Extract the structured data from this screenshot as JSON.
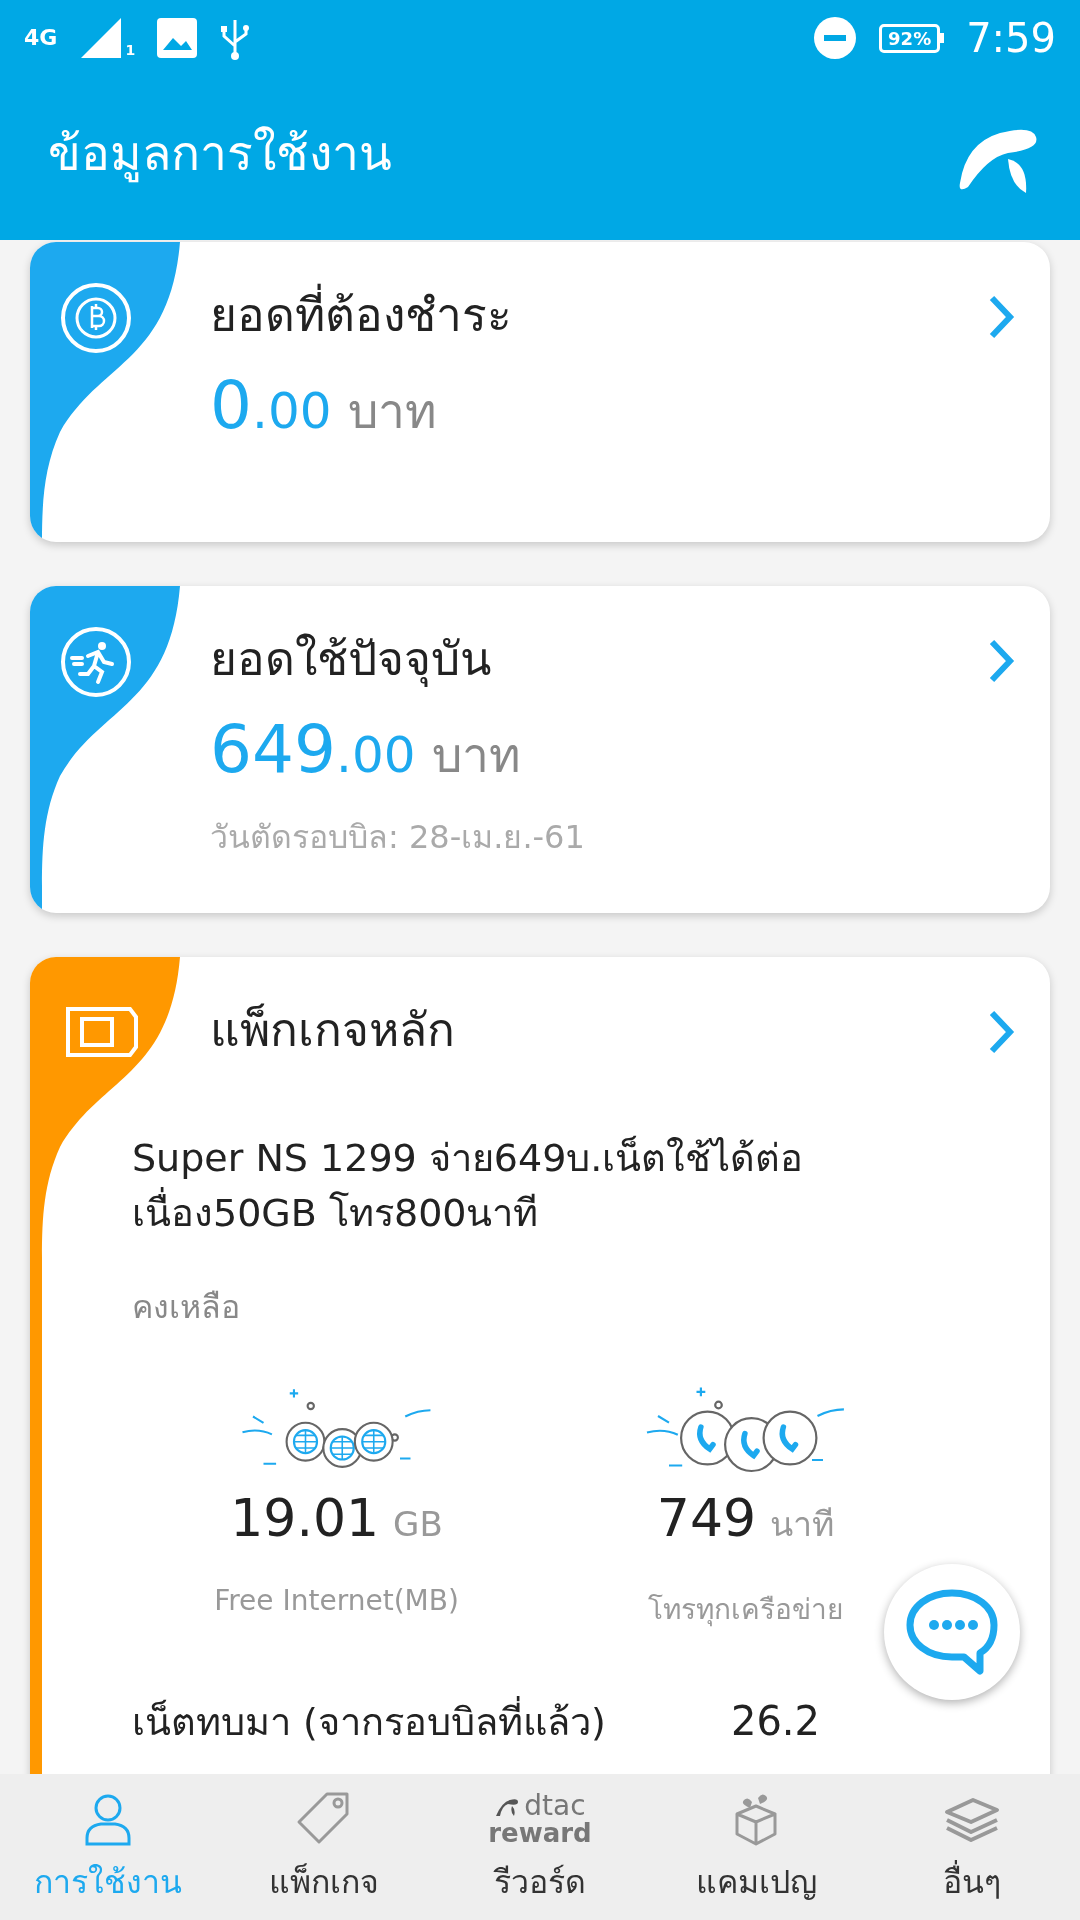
{
  "status_bar": {
    "network": "4G",
    "sim": "1",
    "battery": "92%",
    "time": "7:59"
  },
  "header": {
    "title": "ข้อมูลการใช้งาน"
  },
  "cards": [
    {
      "kind": "bill",
      "color": "#1da9ef",
      "title": "ยอดที่ต้องชำระ",
      "amount_int": "0",
      "amount_dec": ".00",
      "unit": "บาท"
    },
    {
      "kind": "usage",
      "color": "#1da9ef",
      "title": "ยอดใช้ปัจจุบัน",
      "amount_int": "649",
      "amount_dec": ".00",
      "unit": "บาท",
      "note": "วันตัดรอบบิล: 28-เม.ย.-61"
    },
    {
      "kind": "package",
      "color": "#ff9800",
      "title": "แพ็กเกจหลัก",
      "description": "Super NS 1299 จ่าย649บ.เน็ตใช้ได้ต่อเนื่อง50GB โทร800นาที",
      "remaining_label": "คงเหลือ",
      "balances": [
        {
          "kind": "internet",
          "value": "19.01",
          "unit": "GB",
          "label": "Free Internet(MB)"
        },
        {
          "kind": "call",
          "value": "749",
          "unit": "นาที",
          "label": "โทรทุกเครือข่าย"
        }
      ],
      "rollover": {
        "label": "เน็ตทบมา (จากรอบบิลที่แล้ว)",
        "value": "26.2"
      }
    }
  ],
  "nav": [
    {
      "kind": "usage",
      "label": "การใช้งาน",
      "selected": true
    },
    {
      "kind": "package",
      "label": "แพ็กเกจ",
      "selected": false
    },
    {
      "kind": "reward",
      "label": "รีวอร์ด",
      "selected": false,
      "logo_text": [
        "dtac",
        "reward"
      ]
    },
    {
      "kind": "campaign",
      "label": "แคมเปญ",
      "selected": false
    },
    {
      "kind": "more",
      "label": "อื่นๆ",
      "selected": false
    }
  ]
}
